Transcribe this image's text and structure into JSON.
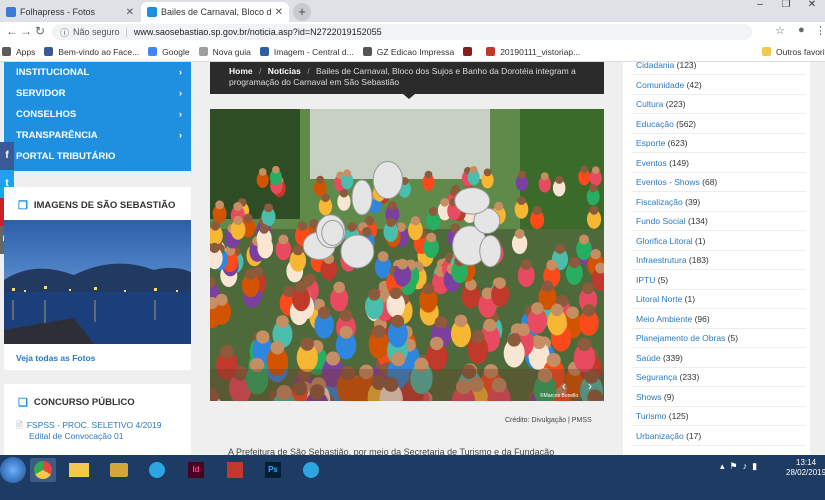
{
  "browser": {
    "tabs": [
      {
        "label": "Folhapress - Fotos",
        "favicon_color": "#3a7bd5"
      },
      {
        "label": "Bailes de Carnaval, Bloco dos Sujo",
        "favicon_color": "#1f8fe0"
      }
    ],
    "address": {
      "security": "Não seguro",
      "url": "www.saosebastiao.sp.gov.br/noticia.asp?id=N2722019152055"
    },
    "bookmarks": [
      {
        "label": "Apps",
        "color": "#5b5b5b"
      },
      {
        "label": "Bem-vindo ao Face...",
        "color": "#3b5998"
      },
      {
        "label": "Google",
        "color": "#4285f4"
      },
      {
        "label": "Nova guia",
        "color": "#9e9e9e"
      },
      {
        "label": "Imagem - Central d...",
        "color": "#2d5fa3"
      },
      {
        "label": "GZ Edicao Impressa",
        "color": "#555"
      },
      {
        "label": "",
        "color": "#8b1c1c"
      },
      {
        "label": "20190111_vistoriap...",
        "color": "#c0392b"
      }
    ],
    "other_favorites": "Outros favoritos"
  },
  "left": {
    "nav": [
      {
        "label": "INSTITUCIONAL",
        "arrow": "›"
      },
      {
        "label": "SERVIDOR",
        "arrow": "›"
      },
      {
        "label": "CONSELHOS",
        "arrow": "›"
      },
      {
        "label": "TRANSPARÊNCIA",
        "arrow": "›"
      },
      {
        "label": "PORTAL TRIBUTÁRIO",
        "arrow": ""
      }
    ],
    "social": [
      {
        "glyph": "f",
        "color": "#3b5998"
      },
      {
        "glyph": "t",
        "color": "#1da1f2"
      },
      {
        "glyph": "P",
        "color": "#cb2027"
      },
      {
        "glyph": "✉",
        "color": "#666"
      }
    ],
    "images_title": "IMAGENS DE SÃO SEBASTIÃO",
    "see_all": "Veja todas as Fotos",
    "concurso_title": "CONCURSO PÚBLICO",
    "concurso_line1": "FSPSS - PROC. SELETIVO 4/2019",
    "concurso_line2": "Edital de Convocação 01"
  },
  "article": {
    "breadcrumb_home": "Home",
    "sep": "/",
    "breadcrumb_section": "Notícias",
    "breadcrumb_title": "Bailes de Carnaval, Bloco dos Sujos e Banho da Dorotéia integram a programação do Carnaval em São Sebastião",
    "credit": "Crédito: Divulgação | PMSS",
    "paragraph": "A Prefeitura de São Sebastião, por meio da Secretaria de Turismo e da Fundação"
  },
  "categories": [
    {
      "name": "Cidadania",
      "count": "(123)"
    },
    {
      "name": "Comunidade",
      "count": "(42)"
    },
    {
      "name": "Cultura",
      "count": "(223)"
    },
    {
      "name": "Educação",
      "count": "(562)"
    },
    {
      "name": "Esporte",
      "count": "(623)"
    },
    {
      "name": "Eventos",
      "count": "(149)"
    },
    {
      "name": "Eventos - Shows",
      "count": "(68)"
    },
    {
      "name": "Fiscalização",
      "count": "(39)"
    },
    {
      "name": "Fundo Social",
      "count": "(134)"
    },
    {
      "name": "Glorifica Litoral",
      "count": "(1)"
    },
    {
      "name": "Infraestrutura",
      "count": "(183)"
    },
    {
      "name": "IPTU",
      "count": "(5)"
    },
    {
      "name": "Litoral Norte",
      "count": "(1)"
    },
    {
      "name": "Meio Ambiente",
      "count": "(96)"
    },
    {
      "name": "Planejamento de Obras",
      "count": "(5)"
    },
    {
      "name": "Saúde",
      "count": "(339)"
    },
    {
      "name": "Segurança",
      "count": "(233)"
    },
    {
      "name": "Shows",
      "count": "(9)"
    },
    {
      "name": "Turismo",
      "count": "(125)"
    },
    {
      "name": "Urbanização",
      "count": "(17)"
    }
  ],
  "taskbar": {
    "apps": [
      {
        "name": "chrome-icon",
        "color": "#e8443a"
      },
      {
        "name": "explorer-icon",
        "color": "#f2c94c"
      },
      {
        "name": "folder-icon",
        "color": "#d4a63a"
      },
      {
        "name": "telegram-icon",
        "color": "#2ca5e0"
      },
      {
        "name": "indesign-icon",
        "color": "#49021f"
      },
      {
        "name": "app-icon",
        "color": "#c0392b"
      },
      {
        "name": "photoshop-icon",
        "color": "#001e36"
      },
      {
        "name": "telegram-icon",
        "color": "#2ca5e0"
      }
    ],
    "id_label": "Id",
    "ps_label": "Ps",
    "time": "13:14",
    "date": "28/02/2019"
  }
}
